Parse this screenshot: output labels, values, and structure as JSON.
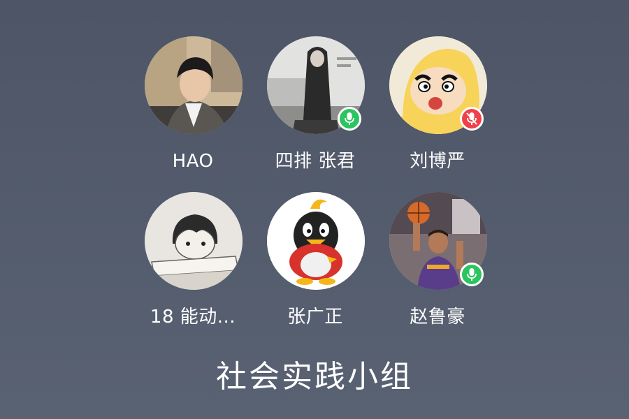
{
  "call": {
    "group_name": "社会实践小组",
    "members": [
      {
        "name": "HAO",
        "avatar": "young-man-portrait",
        "mic": "none"
      },
      {
        "name": "四排 张君",
        "avatar": "long-hair-woman-photo",
        "mic": "on"
      },
      {
        "name": "刘博严",
        "avatar": "crayon-shin-chan-raincoat",
        "mic": "muted"
      },
      {
        "name": "18 能动...",
        "avatar": "sketch-boy-drawing",
        "mic": "none"
      },
      {
        "name": "张广正",
        "avatar": "qq-penguin",
        "mic": "none"
      },
      {
        "name": "赵鲁豪",
        "avatar": "basketball-player-photo",
        "mic": "on"
      }
    ]
  },
  "colors": {
    "background": "#4f5769",
    "mic_on": "#2bc560",
    "mic_muted": "#f0414b"
  }
}
